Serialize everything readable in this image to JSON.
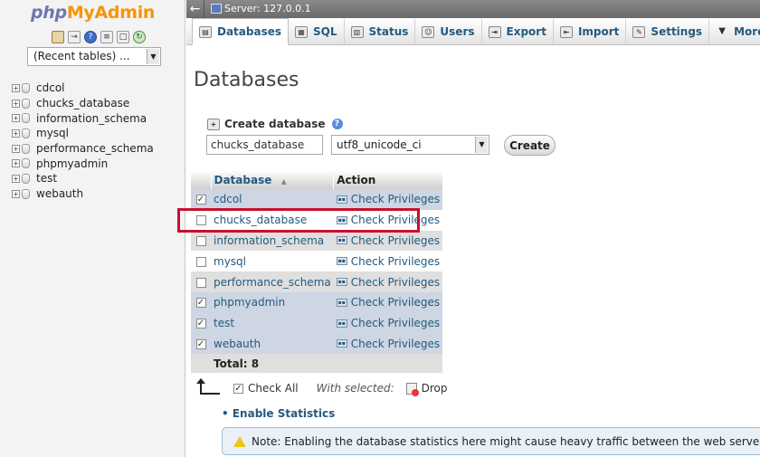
{
  "app": {
    "logo_php": "php",
    "logo_myadmin": "MyAdmin"
  },
  "left_panel": {
    "recent_tables": "(Recent tables) ...",
    "databases": [
      "cdcol",
      "chucks_database",
      "information_schema",
      "mysql",
      "performance_schema",
      "phpmyadmin",
      "test",
      "webauth"
    ]
  },
  "topbar": {
    "back": "←",
    "server": "Server: 127.0.0.1"
  },
  "tabs": [
    {
      "label": "Databases",
      "icon": "databases-icon",
      "active": true
    },
    {
      "label": "SQL",
      "icon": "sql-icon"
    },
    {
      "label": "Status",
      "icon": "status-icon"
    },
    {
      "label": "Users",
      "icon": "users-icon"
    },
    {
      "label": "Export",
      "icon": "export-icon"
    },
    {
      "label": "Import",
      "icon": "import-icon"
    },
    {
      "label": "Settings",
      "icon": "settings-icon"
    },
    {
      "label": "More",
      "icon": "more-icon"
    }
  ],
  "main": {
    "title": "Databases",
    "create_label": "Create database",
    "new_db_value": "chucks_database",
    "collation": "utf8_unicode_ci",
    "create_button": "Create"
  },
  "table": {
    "col_database": "Database",
    "col_action": "Action",
    "action_label": "Check Privileges",
    "rows": [
      {
        "name": "cdcol",
        "checked": true
      },
      {
        "name": "chucks_database",
        "checked": false
      },
      {
        "name": "information_schema",
        "checked": false
      },
      {
        "name": "mysql",
        "checked": false
      },
      {
        "name": "performance_schema",
        "checked": false
      },
      {
        "name": "phpmyadmin",
        "checked": true
      },
      {
        "name": "test",
        "checked": true
      },
      {
        "name": "webauth",
        "checked": true
      }
    ],
    "total": "Total: 8"
  },
  "footer": {
    "check_all": "Check All",
    "with_selected": "With selected:",
    "drop": "Drop"
  },
  "stats": {
    "enable": "Enable Statistics",
    "note": "Note: Enabling the database statistics here might cause heavy traffic between the web server and the MySQL server."
  },
  "colors": {
    "link": "#235a81",
    "highlight": "#c8102e",
    "logo_php": "#6c78af",
    "logo_myadmin": "#f89406"
  }
}
